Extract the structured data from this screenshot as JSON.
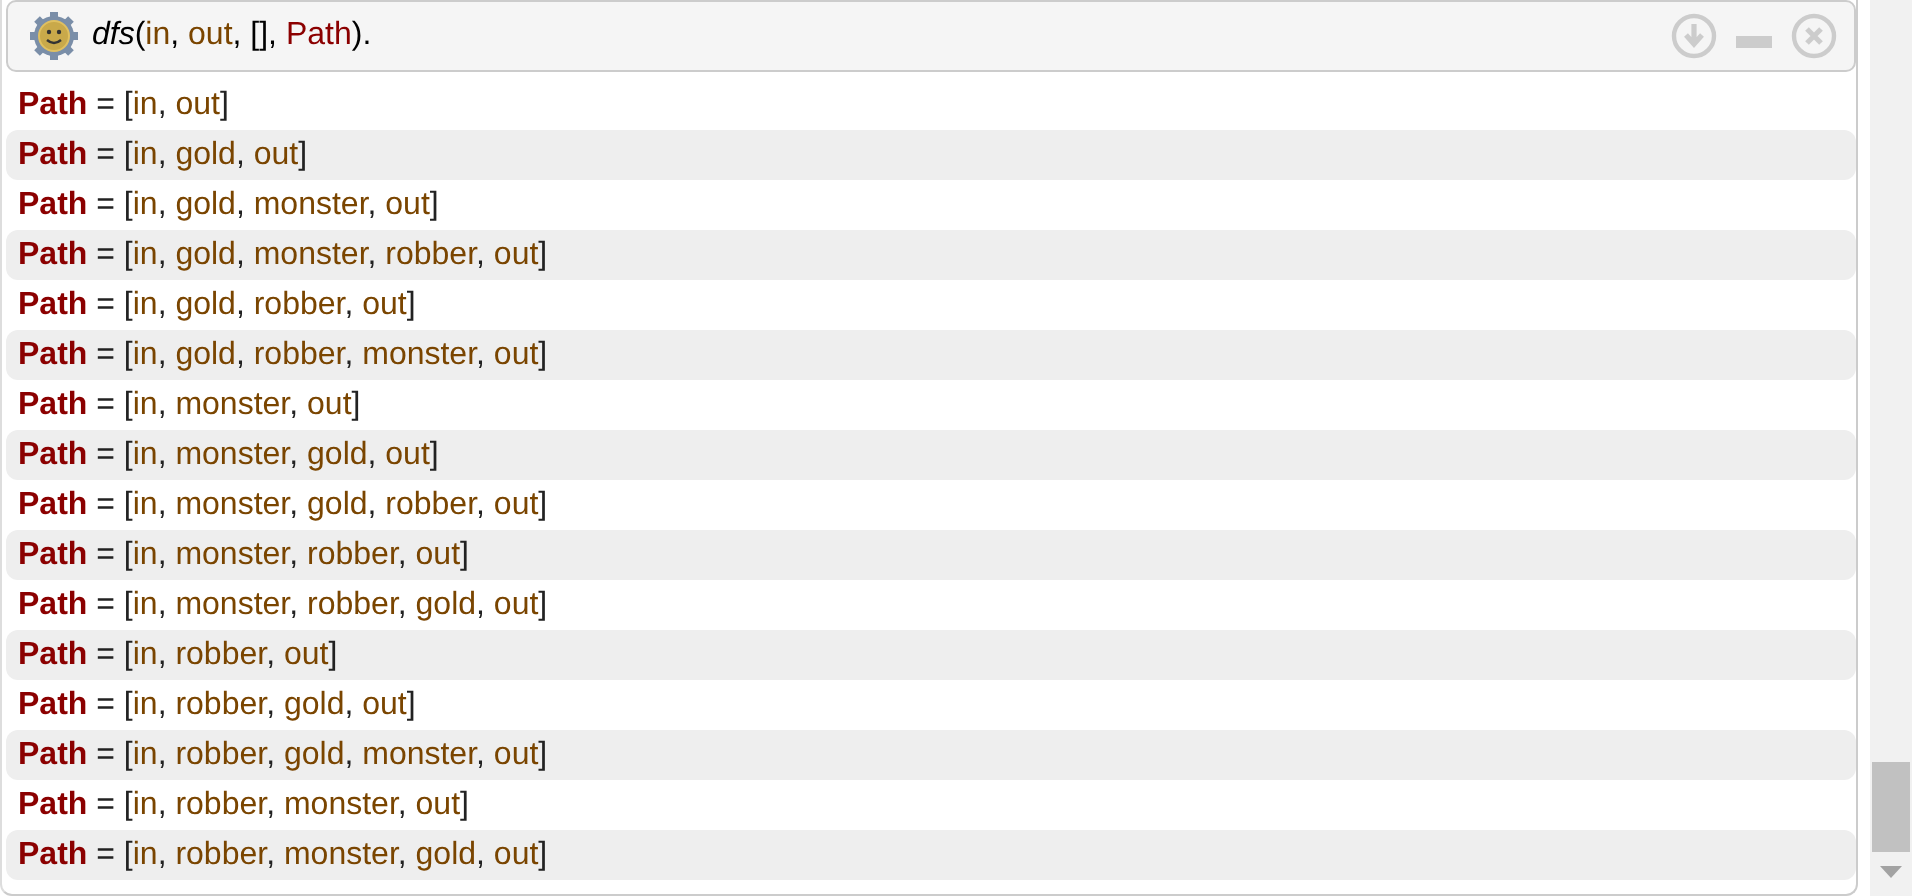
{
  "query": [
    {
      "text": "dfs",
      "kind": "functor"
    },
    {
      "text": "(",
      "kind": "punct"
    },
    {
      "text": "in",
      "kind": "atom"
    },
    {
      "text": ", ",
      "kind": "punct"
    },
    {
      "text": "out",
      "kind": "atom"
    },
    {
      "text": ", ",
      "kind": "punct"
    },
    {
      "text": "[]",
      "kind": "punct"
    },
    {
      "text": ", ",
      "kind": "punct"
    },
    {
      "text": "Path",
      "kind": "var"
    },
    {
      "text": ").",
      "kind": "punct"
    }
  ],
  "answers": [
    {
      "variable": "Path",
      "equals": "=",
      "open": "[",
      "separator": ",",
      "close": "]",
      "atoms": [
        "in",
        "out"
      ]
    },
    {
      "variable": "Path",
      "equals": "=",
      "open": "[",
      "separator": ",",
      "close": "]",
      "atoms": [
        "in",
        "gold",
        "out"
      ]
    },
    {
      "variable": "Path",
      "equals": "=",
      "open": "[",
      "separator": ",",
      "close": "]",
      "atoms": [
        "in",
        "gold",
        "monster",
        "out"
      ]
    },
    {
      "variable": "Path",
      "equals": "=",
      "open": "[",
      "separator": ",",
      "close": "]",
      "atoms": [
        "in",
        "gold",
        "monster",
        "robber",
        "out"
      ]
    },
    {
      "variable": "Path",
      "equals": "=",
      "open": "[",
      "separator": ",",
      "close": "]",
      "atoms": [
        "in",
        "gold",
        "robber",
        "out"
      ]
    },
    {
      "variable": "Path",
      "equals": "=",
      "open": "[",
      "separator": ",",
      "close": "]",
      "atoms": [
        "in",
        "gold",
        "robber",
        "monster",
        "out"
      ]
    },
    {
      "variable": "Path",
      "equals": "=",
      "open": "[",
      "separator": ",",
      "close": "]",
      "atoms": [
        "in",
        "monster",
        "out"
      ]
    },
    {
      "variable": "Path",
      "equals": "=",
      "open": "[",
      "separator": ",",
      "close": "]",
      "atoms": [
        "in",
        "monster",
        "gold",
        "out"
      ]
    },
    {
      "variable": "Path",
      "equals": "=",
      "open": "[",
      "separator": ",",
      "close": "]",
      "atoms": [
        "in",
        "monster",
        "gold",
        "robber",
        "out"
      ]
    },
    {
      "variable": "Path",
      "equals": "=",
      "open": "[",
      "separator": ",",
      "close": "]",
      "atoms": [
        "in",
        "monster",
        "robber",
        "out"
      ]
    },
    {
      "variable": "Path",
      "equals": "=",
      "open": "[",
      "separator": ",",
      "close": "]",
      "atoms": [
        "in",
        "monster",
        "robber",
        "gold",
        "out"
      ]
    },
    {
      "variable": "Path",
      "equals": "=",
      "open": "[",
      "separator": ",",
      "close": "]",
      "atoms": [
        "in",
        "robber",
        "out"
      ]
    },
    {
      "variable": "Path",
      "equals": "=",
      "open": "[",
      "separator": ",",
      "close": "]",
      "atoms": [
        "in",
        "robber",
        "gold",
        "out"
      ]
    },
    {
      "variable": "Path",
      "equals": "=",
      "open": "[",
      "separator": ",",
      "close": "]",
      "atoms": [
        "in",
        "robber",
        "gold",
        "monster",
        "out"
      ]
    },
    {
      "variable": "Path",
      "equals": "=",
      "open": "[",
      "separator": ",",
      "close": "]",
      "atoms": [
        "in",
        "robber",
        "monster",
        "out"
      ]
    },
    {
      "variable": "Path",
      "equals": "=",
      "open": "[",
      "separator": ",",
      "close": "]",
      "atoms": [
        "in",
        "robber",
        "monster",
        "gold",
        "out"
      ]
    }
  ]
}
